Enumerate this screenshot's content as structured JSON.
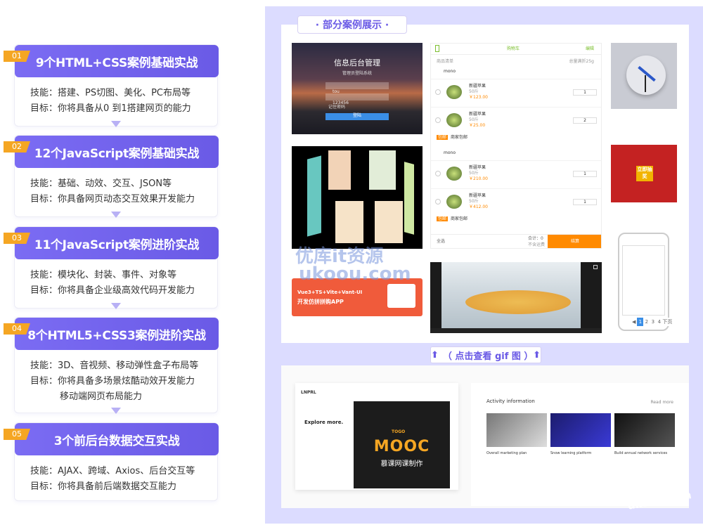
{
  "courses": [
    {
      "num": "01",
      "title": "9个HTML+CSS案例基础实战",
      "lines": [
        "技能：搭建、PS切图、美化、PC布局等",
        "目标：你将具备从0 到1搭建网页的能力"
      ]
    },
    {
      "num": "02",
      "title": "12个JavaScript案例基础实战",
      "lines": [
        "技能：基础、动效、交互、JSON等",
        "目标：你具备网页动态交互效果开发能力"
      ]
    },
    {
      "num": "03",
      "title": "11个JavaScript案例进阶实战",
      "lines": [
        "技能：模块化、封装、事件、对象等",
        "目标：你将具备企业级高效代码开发能力"
      ]
    },
    {
      "num": "04",
      "title": "8个HTML5+CSS3案例进阶实战",
      "lines": [
        "技能：3D、音视频、移动弹性盒子布局等",
        "目标：你将具备多场景炫酷动效开发能力",
        "移动端网页布局能力"
      ]
    },
    {
      "num": "05",
      "title": "3个前后台数据交互实战",
      "lines": [
        "技能：AJAX、跨域、Axios、后台交互等",
        "目标：你将具备前后端数据交互能力"
      ]
    }
  ],
  "showcase": {
    "title": "· 部分案例展示 ·",
    "gif_link": "（ 点击查看 gif 图 ）"
  },
  "login": {
    "title": "信息后台管理",
    "subtitle": "管理员登陆系统",
    "user": "tou",
    "pwd": "123456",
    "remember": "记住密码",
    "submit": "登陆"
  },
  "cart": {
    "header": "购物车",
    "edit": "编辑",
    "shop_label": "商品清单",
    "discount": "总量满折25g",
    "stores": [
      {
        "name": "mono",
        "items": [
          {
            "name": "新疆苹果",
            "unit": "50斤",
            "price": "￥123.00",
            "qty": "1"
          },
          {
            "name": "新疆苹果",
            "unit": "50斤",
            "price": "￥25.00",
            "qty": "2"
          }
        ],
        "promo": "包邮",
        "promo_text": "商家包邮"
      },
      {
        "name": "mono",
        "items": [
          {
            "name": "新疆苹果",
            "unit": "50斤",
            "price": "￥210.00",
            "qty": "1"
          },
          {
            "name": "新疆苹果",
            "unit": "50斤",
            "price": "￥412.00",
            "qty": "1"
          }
        ],
        "promo": "包邮",
        "promo_text": "商家包邮"
      }
    ],
    "select_all": "全选",
    "total": "合计：0",
    "not_shipping": "不含运费",
    "checkout": "结算"
  },
  "lottery": {
    "center": "立即抽奖"
  },
  "banner": {
    "line1": "Vue3+TS+Vite+Vant-UI",
    "line2": "开发仿拼拼购APP"
  },
  "pager": {
    "items": [
      "1",
      "2",
      "3",
      "4"
    ],
    "prev": "◀",
    "next": "下页"
  },
  "web1": {
    "logo": "LNPRL",
    "title": "Explore more.",
    "brand": "MOOC",
    "brand_sub": "慕课网课制作",
    "tag": "TOGO"
  },
  "web2": {
    "title": "Activity information",
    "more": "Read more",
    "cards": [
      {
        "title": "Overall marketing plan"
      },
      {
        "title": "Snow learning platform"
      },
      {
        "title": "Build annual network services"
      }
    ]
  },
  "watermarks": {
    "wm1": "优库it资源",
    "wm2": "ukoou.com",
    "wm3": "ukoou.com"
  },
  "colors": {
    "accent": "#6a5ae6",
    "badge": "#f5a623",
    "panel": "#dcdcff",
    "orange": "#ff8a00",
    "green": "#7cbf2f"
  }
}
